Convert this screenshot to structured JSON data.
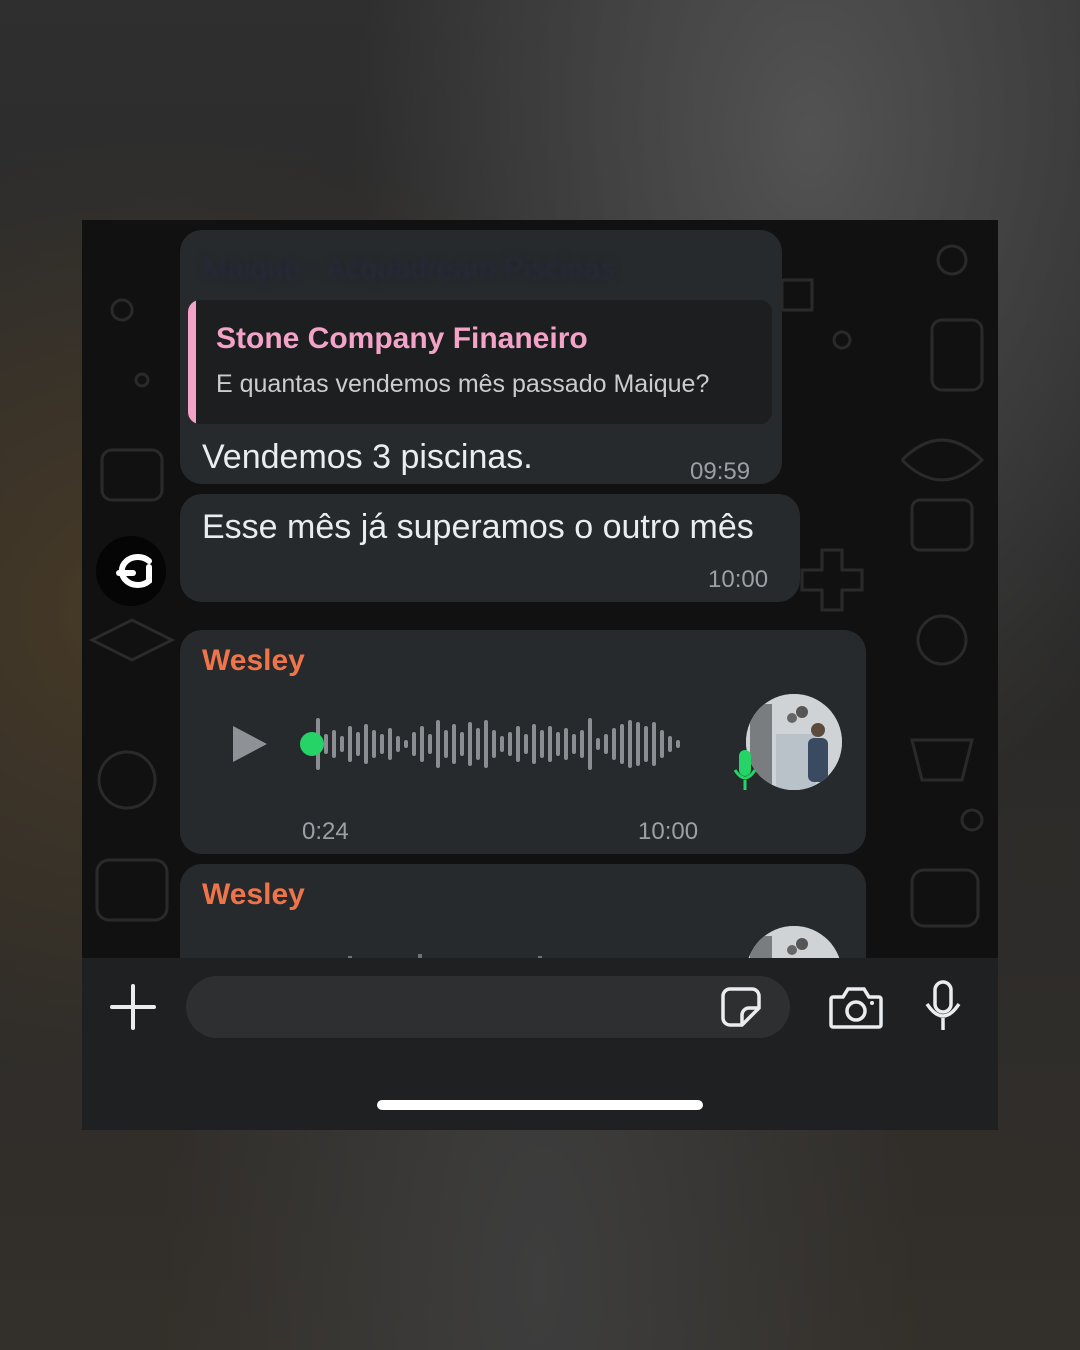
{
  "conversation": {
    "hidden_header": "Maique - Acquadream Piscinas",
    "messages": [
      {
        "quote": {
          "name": "Stone Company Finaneiro",
          "text": "E quantas vendemos mês passado Maique?"
        },
        "text": "Vendemos 3 piscinas.",
        "time": "09:59"
      },
      {
        "text": "Esse mês já superamos o outro mês",
        "time": "10:00"
      },
      {
        "sender": "Wesley",
        "type": "voice",
        "duration": "0:24",
        "time": "10:00"
      },
      {
        "sender": "Wesley",
        "type": "voice"
      }
    ]
  },
  "colors": {
    "quote_accent": "#f2a3c7",
    "sender_accent": "#f0744a",
    "playhead": "#25d366",
    "mic": "#25d366"
  },
  "icons": {
    "attach": "plus-icon",
    "sticker": "sticker-icon",
    "camera": "camera-icon",
    "mic": "microphone-icon",
    "play": "play-icon"
  },
  "composer": {
    "placeholder": ""
  }
}
